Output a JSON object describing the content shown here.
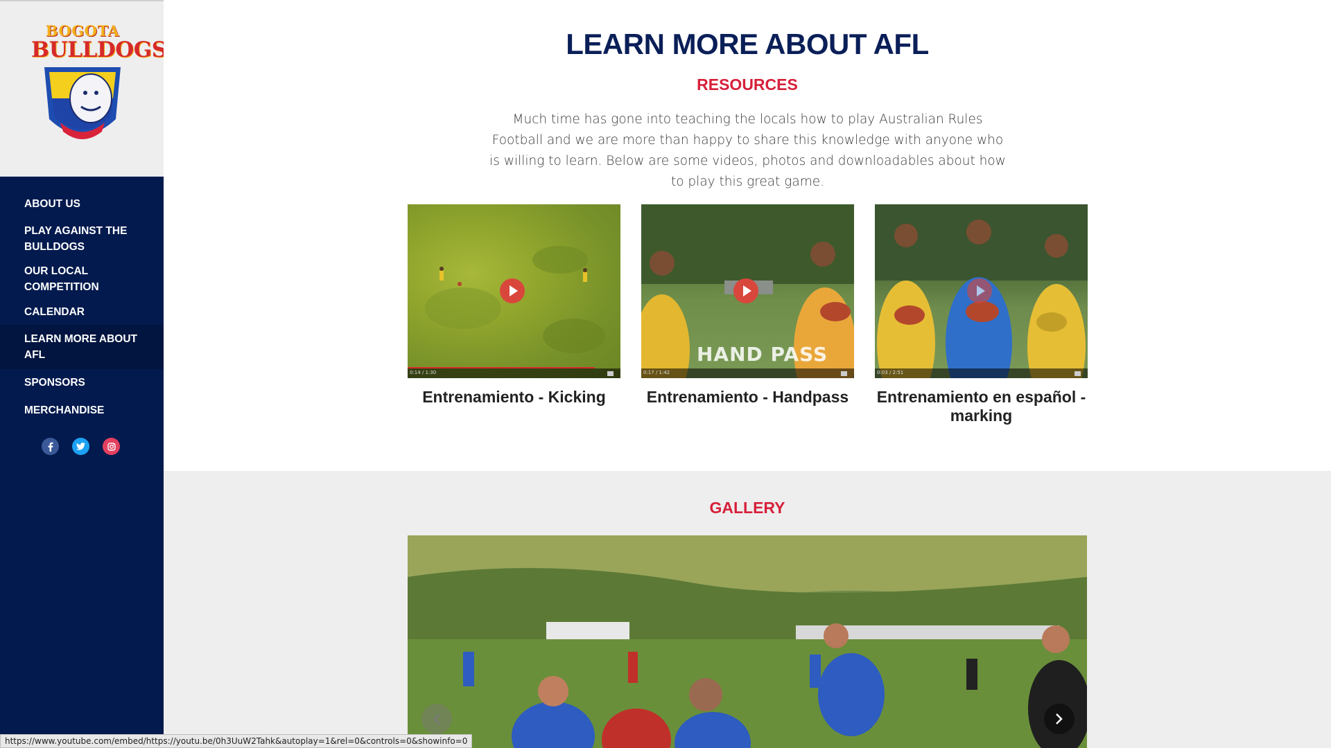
{
  "logo": {
    "line1": "BOGOTA",
    "line2": "BULLDOGS"
  },
  "nav": {
    "items": [
      {
        "label": "ABOUT US"
      },
      {
        "label": "PLAY AGAINST THE BULLDOGS"
      },
      {
        "label": "OUR LOCAL COMPETITION"
      },
      {
        "label": "CALENDAR"
      },
      {
        "label": "LEARN MORE ABOUT AFL",
        "active": true
      },
      {
        "label": "SPONSORS"
      },
      {
        "label": "MERCHANDISE"
      }
    ]
  },
  "social": [
    {
      "icon": "facebook-icon",
      "color": "#3b5998"
    },
    {
      "icon": "twitter-icon",
      "color": "#1da1f2"
    },
    {
      "icon": "instagram-icon",
      "color": "#e4405f"
    }
  ],
  "page": {
    "title": "LEARN MORE ABOUT AFL",
    "subtitle": "RESOURCES",
    "intro": "Much time has gone into teaching the locals how to play Australian Rules Football and we are more than happy to share this knowledge with anyone who is willing to learn. Below are some videos, photos and downloadables about how to play this great game."
  },
  "videos": [
    {
      "title": "Entrenamiento - Kicking",
      "time": "0:14 / 1:30",
      "progress": 0.12
    },
    {
      "title": "Entrenamiento - Handpass",
      "time": "0:17 / 1:42",
      "overlay": "HAND PASS",
      "progress": 0.1
    },
    {
      "title": "Entrenamiento en español - marking",
      "time": "0:03 / 2:51",
      "progress": 0.02
    }
  ],
  "gallery": {
    "title": "GALLERY"
  },
  "status_bar": {
    "url": "https://www.youtube.com/embed/https://youtu.be/0h3UuW2Tahk&autoplay=1&rel=0&controls=0&showinfo=0"
  },
  "colors": {
    "navy": "#031a4e",
    "title": "#0a1f58",
    "accent_red": "#d6203a"
  }
}
